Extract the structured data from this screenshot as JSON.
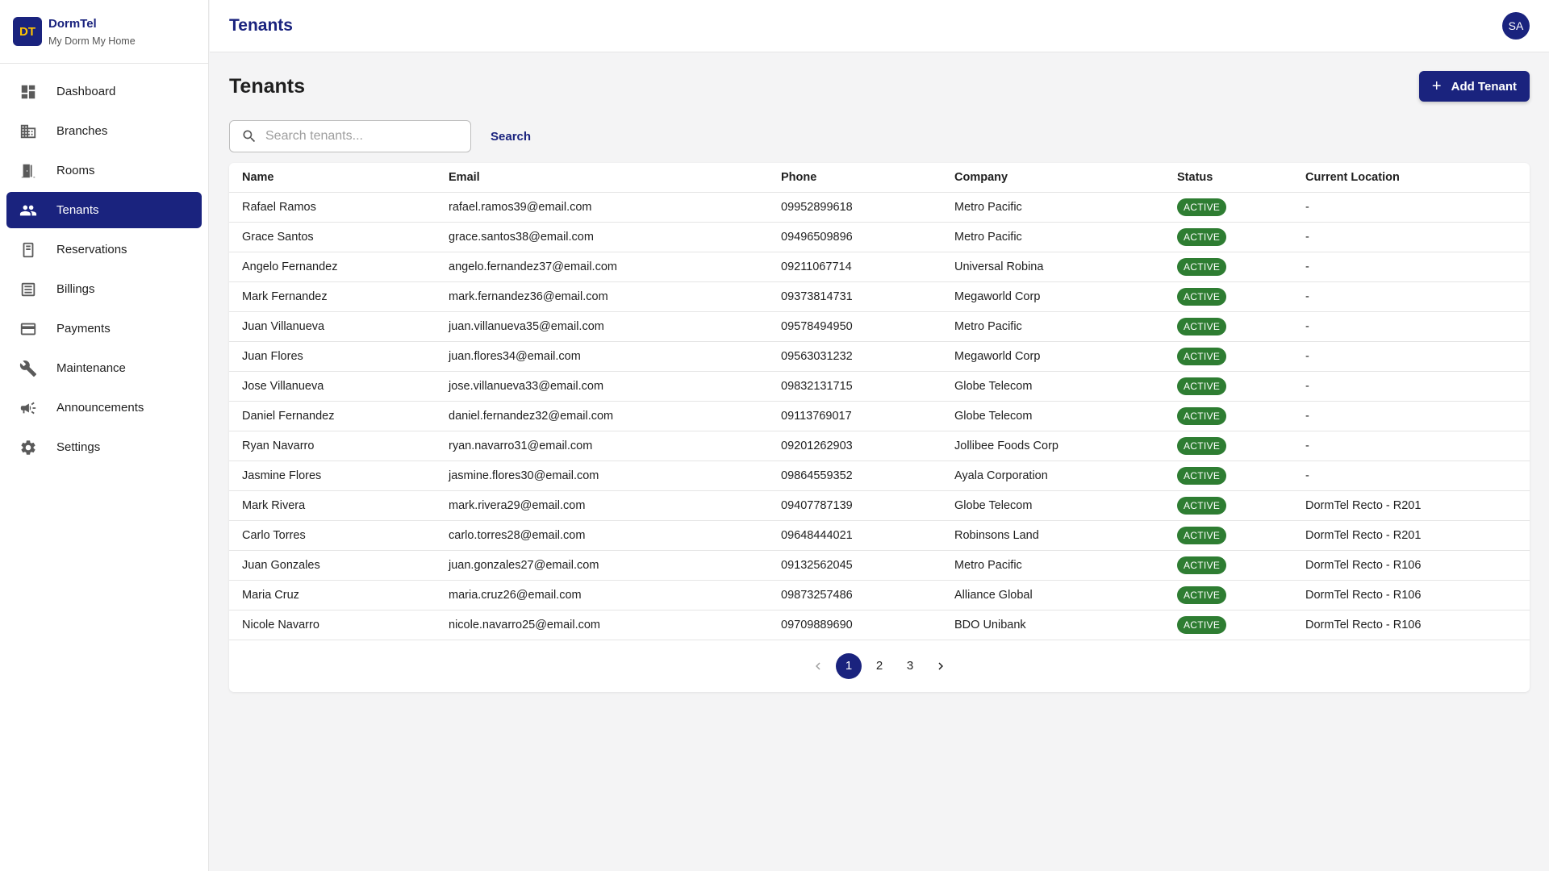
{
  "brand": {
    "logo": "DT",
    "name": "DormTel",
    "tagline": "My Dorm My Home"
  },
  "sidebar": {
    "items": [
      {
        "label": "Dashboard",
        "icon": "dashboard-icon"
      },
      {
        "label": "Branches",
        "icon": "building-icon"
      },
      {
        "label": "Rooms",
        "icon": "door-icon"
      },
      {
        "label": "Tenants",
        "icon": "people-icon",
        "active": true
      },
      {
        "label": "Reservations",
        "icon": "calendar-icon"
      },
      {
        "label": "Billings",
        "icon": "receipt-icon"
      },
      {
        "label": "Payments",
        "icon": "card-icon"
      },
      {
        "label": "Maintenance",
        "icon": "wrench-icon"
      },
      {
        "label": "Announcements",
        "icon": "megaphone-icon"
      },
      {
        "label": "Settings",
        "icon": "gear-icon"
      }
    ]
  },
  "header": {
    "title": "Tenants",
    "avatar": "SA"
  },
  "main": {
    "title": "Tenants",
    "add_label": "Add Tenant",
    "search": {
      "placeholder": "Search tenants...",
      "button": "Search"
    },
    "columns": [
      "Name",
      "Email",
      "Phone",
      "Company",
      "Status",
      "Current Location"
    ],
    "rows": [
      [
        "Rafael Ramos",
        "rafael.ramos39@email.com",
        "09952899618",
        "Metro Pacific",
        "ACTIVE",
        "-"
      ],
      [
        "Grace Santos",
        "grace.santos38@email.com",
        "09496509896",
        "Metro Pacific",
        "ACTIVE",
        "-"
      ],
      [
        "Angelo Fernandez",
        "angelo.fernandez37@email.com",
        "09211067714",
        "Universal Robina",
        "ACTIVE",
        "-"
      ],
      [
        "Mark Fernandez",
        "mark.fernandez36@email.com",
        "09373814731",
        "Megaworld Corp",
        "ACTIVE",
        "-"
      ],
      [
        "Juan Villanueva",
        "juan.villanueva35@email.com",
        "09578494950",
        "Metro Pacific",
        "ACTIVE",
        "-"
      ],
      [
        "Juan Flores",
        "juan.flores34@email.com",
        "09563031232",
        "Megaworld Corp",
        "ACTIVE",
        "-"
      ],
      [
        "Jose Villanueva",
        "jose.villanueva33@email.com",
        "09832131715",
        "Globe Telecom",
        "ACTIVE",
        "-"
      ],
      [
        "Daniel Fernandez",
        "daniel.fernandez32@email.com",
        "09113769017",
        "Globe Telecom",
        "ACTIVE",
        "-"
      ],
      [
        "Ryan Navarro",
        "ryan.navarro31@email.com",
        "09201262903",
        "Jollibee Foods Corp",
        "ACTIVE",
        "-"
      ],
      [
        "Jasmine Flores",
        "jasmine.flores30@email.com",
        "09864559352",
        "Ayala Corporation",
        "ACTIVE",
        "-"
      ],
      [
        "Mark Rivera",
        "mark.rivera29@email.com",
        "09407787139",
        "Globe Telecom",
        "ACTIVE",
        "DormTel Recto - R201"
      ],
      [
        "Carlo Torres",
        "carlo.torres28@email.com",
        "09648444021",
        "Robinsons Land",
        "ACTIVE",
        "DormTel Recto - R201"
      ],
      [
        "Juan Gonzales",
        "juan.gonzales27@email.com",
        "09132562045",
        "Metro Pacific",
        "ACTIVE",
        "DormTel Recto - R106"
      ],
      [
        "Maria Cruz",
        "maria.cruz26@email.com",
        "09873257486",
        "Alliance Global",
        "ACTIVE",
        "DormTel Recto - R106"
      ],
      [
        "Nicole Navarro",
        "nicole.navarro25@email.com",
        "09709889690",
        "BDO Unibank",
        "ACTIVE",
        "DormTel Recto - R106"
      ]
    ],
    "pagination": {
      "pages": [
        "1",
        "2",
        "3"
      ],
      "current": "1"
    }
  },
  "colors": {
    "primary": "#1a237e",
    "active_badge": "#2e7d32",
    "logo_text": "#ffc400"
  }
}
